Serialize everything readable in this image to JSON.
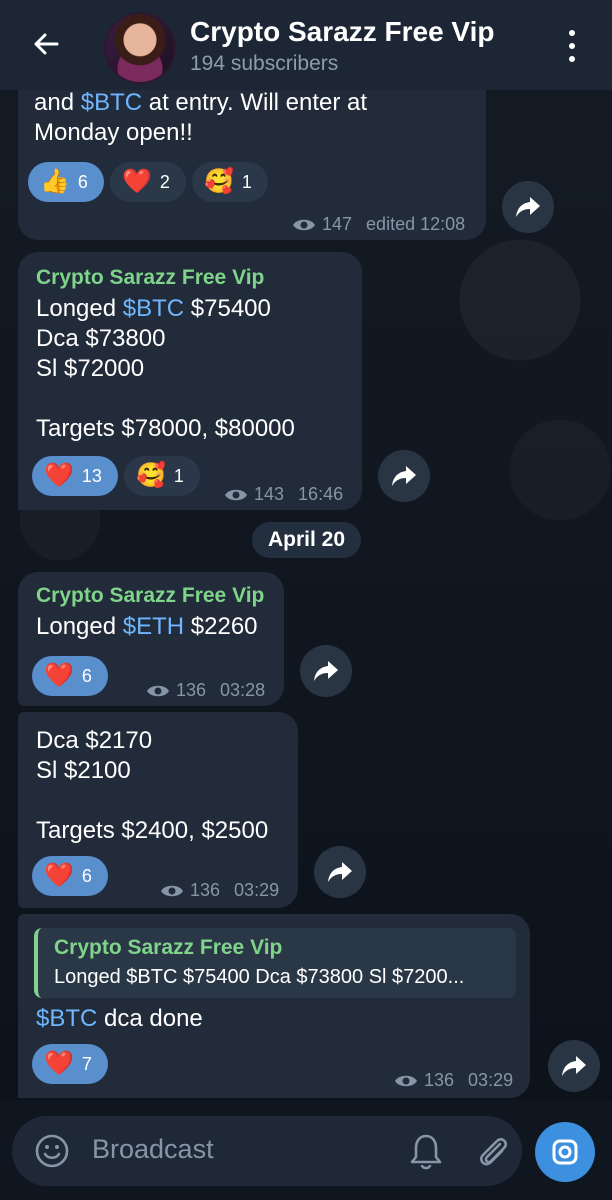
{
  "header": {
    "title": "Crypto Sarazz Free Vip",
    "subtitle": "194 subscribers"
  },
  "messages": [
    {
      "text_prefix": "and ",
      "hashtag": "$BTC",
      "text_suffix": " at entry. Will enter at",
      "line2": "Monday open!!",
      "reactions": [
        {
          "emoji": "👍",
          "count": "6",
          "active": true
        },
        {
          "emoji": "❤️",
          "count": "2",
          "active": false
        },
        {
          "emoji": "🥰",
          "count": "1",
          "active": false
        }
      ],
      "views": "147",
      "time": "edited 12:08"
    },
    {
      "sender": "Crypto Sarazz Free Vip",
      "line1_prefix": "Longed ",
      "hashtag": "$BTC",
      "line1_suffix": " $75400",
      "line2": "Dca $73800",
      "line3": "Sl $72000",
      "line4": "Targets $78000, $80000",
      "reactions": [
        {
          "emoji": "❤️",
          "count": "13",
          "active": true
        },
        {
          "emoji": "🥰",
          "count": "1",
          "active": false
        }
      ],
      "views": "143",
      "time": "16:46"
    },
    {
      "sender": "Crypto Sarazz Free Vip",
      "line1_prefix": "Longed ",
      "hashtag": "$ETH",
      "line1_suffix": " $2260",
      "reactions": [
        {
          "emoji": "❤️",
          "count": "6",
          "active": true
        }
      ],
      "views": "136",
      "time": "03:28"
    },
    {
      "line1": "Dca $2170",
      "line2": "Sl $2100",
      "line3": "Targets $2400, $2500",
      "reactions": [
        {
          "emoji": "❤️",
          "count": "6",
          "active": true
        }
      ],
      "views": "136",
      "time": "03:29"
    },
    {
      "quote_sender": "Crypto Sarazz Free Vip",
      "quote_text": "Longed $BTC $75400 Dca $73800 Sl $7200...",
      "hashtag": "$BTC",
      "text_suffix": " dca done",
      "reactions": [
        {
          "emoji": "❤️",
          "count": "7",
          "active": true
        }
      ],
      "views": "136",
      "time": "03:29"
    }
  ],
  "date_separator": "April 20",
  "composer": {
    "placeholder": "Broadcast"
  },
  "icons": {
    "back": "arrow-left-icon",
    "menu": "more-vertical-icon",
    "share": "share-forward-icon",
    "views": "eye-icon",
    "emoji": "smiley-icon",
    "bell": "bell-icon",
    "attach": "paperclip-icon",
    "camera": "camera-icon"
  },
  "colors": {
    "header_bg": "#1c2634",
    "bubble_bg": "#212b39",
    "sender": "#7fd38a",
    "hashtag": "#6fb6ff",
    "reaction_active": "#5a8fcd",
    "accent": "#3d8fe0"
  }
}
